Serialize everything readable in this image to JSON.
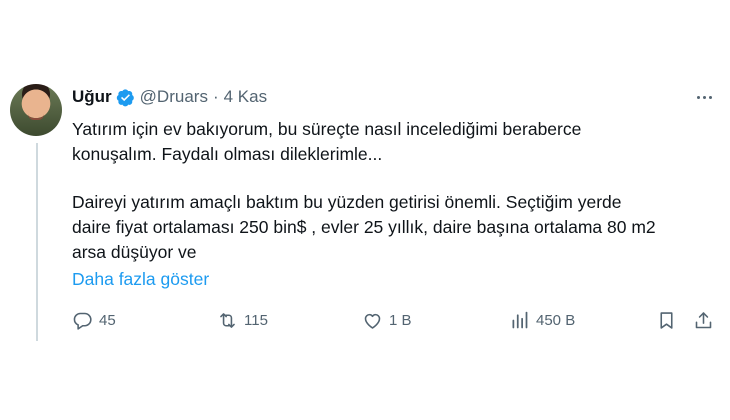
{
  "author": {
    "name": "Uğur",
    "handle": "@Druars",
    "separator": "·",
    "time": "4 Kas",
    "verified": true
  },
  "tweet": {
    "paragraph1_line1": "Yatırım için ev bakıyorum, bu süreçte nasıl incelediğimi beraberce",
    "paragraph1_line2": "konuşalım. Faydalı olması dileklerimle...",
    "paragraph2_line1": "Daireyi yatırım amaçlı baktım bu yüzden getirisi önemli. Seçtiğim yerde",
    "paragraph2_line2": "daire fiyat ortalaması 250 bin$ , evler 25 yıllık, daire başına ortalama 80 m2",
    "paragraph2_line3": "arsa düşüyor ve",
    "show_more": "Daha fazla göster"
  },
  "actions": {
    "replies": "45",
    "retweets": "115",
    "likes": "1 B",
    "views": "450 B"
  },
  "icons": {
    "more": "more-horizontal-icon",
    "verified": "verified-badge-icon",
    "reply": "reply-icon",
    "retweet": "retweet-icon",
    "like": "heart-icon",
    "views": "views-chart-icon",
    "bookmark": "bookmark-icon",
    "share": "share-icon"
  },
  "colors": {
    "accent": "#1d9bf0",
    "secondary_text": "#536471",
    "primary_text": "#0f1419"
  }
}
